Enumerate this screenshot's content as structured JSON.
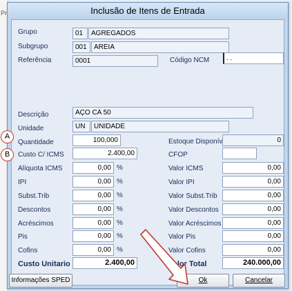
{
  "background": {
    "partial_text": "Pr"
  },
  "window": {
    "title": "Inclusão de Itens de Entrada"
  },
  "labels": {
    "grupo": "Grupo",
    "subgrupo": "Subgrupo",
    "referencia": "Referência",
    "codigo_ncm": "Código NCM",
    "descricao": "Descrição",
    "unidade": "Unidade",
    "quantidade": "Quantidade",
    "estoque": "Estoque Disponível",
    "custo": "Custo C/ ICMS",
    "cfop": "CFOP",
    "aliquota": "Alíquota ICMS",
    "valor_icms": "Valor ICMS",
    "ipi": "IPI",
    "valor_ipi": "Valor IPI",
    "subst": "Subst.Trib",
    "valor_subst": "Valor Subst.Trib",
    "descontos": "Descontos",
    "valor_descontos": "Valor Descontos",
    "acrescimos": "Acréscimos",
    "valor_acrescimos": "Valor Acréscimos",
    "pis": "Pis",
    "valor_pis": "Valor Pis",
    "cofins": "Cofins",
    "valor_cofins": "Valor Cofins",
    "custo_unitario": "Custo Unitario",
    "valor_total": "Valor Total"
  },
  "values": {
    "grupo_code": "01",
    "grupo_name": "AGREGADOS",
    "subgrupo_code": "001",
    "subgrupo_name": "AREIA",
    "referencia": "0001",
    "ncm": ". .",
    "descricao": "AÇO CA 50",
    "unidade_code": "UN",
    "unidade_name": "UNIDADE",
    "quantidade": "100,000",
    "estoque": "0",
    "custo": "2.400,00",
    "cfop": "",
    "aliquota": "0,00",
    "valor_icms": "0,00",
    "ipi": "0,00",
    "valor_ipi": "0,00",
    "subst": "0,00",
    "valor_subst": "0,00",
    "descontos": "0,00",
    "valor_descontos": "0,00",
    "acrescimos": "0,00",
    "valor_acrescimos": "0,00",
    "pis": "0,00",
    "valor_pis": "0,00",
    "cofins": "0,00",
    "valor_cofins": "0,00",
    "custo_unitario": "2.400,00",
    "valor_total": "240.000,00"
  },
  "percent_symbol": "%",
  "buttons": {
    "info_sped": "Informações SPED",
    "ok": "Ok",
    "cancelar": "Cancelar"
  },
  "markers": {
    "a": "A",
    "b": "B"
  },
  "colors": {
    "annotation_red": "#c0392b"
  }
}
